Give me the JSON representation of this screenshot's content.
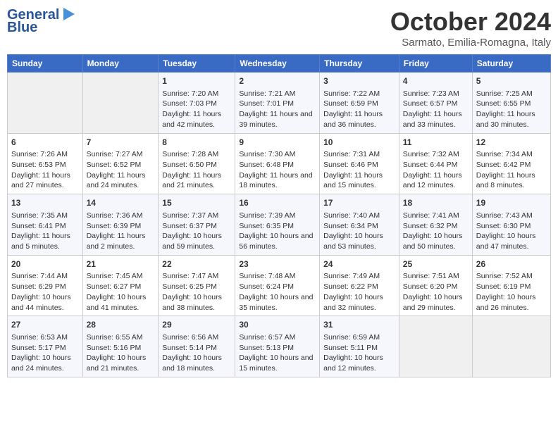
{
  "header": {
    "logo_line1": "General",
    "logo_line2": "Blue",
    "month_title": "October 2024",
    "location": "Sarmato, Emilia-Romagna, Italy"
  },
  "days_of_week": [
    "Sunday",
    "Monday",
    "Tuesday",
    "Wednesday",
    "Thursday",
    "Friday",
    "Saturday"
  ],
  "weeks": [
    [
      {
        "day": "",
        "empty": true
      },
      {
        "day": "",
        "empty": true
      },
      {
        "day": "1",
        "sunrise": "7:20 AM",
        "sunset": "7:03 PM",
        "daylight": "11 hours and 42 minutes."
      },
      {
        "day": "2",
        "sunrise": "7:21 AM",
        "sunset": "7:01 PM",
        "daylight": "11 hours and 39 minutes."
      },
      {
        "day": "3",
        "sunrise": "7:22 AM",
        "sunset": "6:59 PM",
        "daylight": "11 hours and 36 minutes."
      },
      {
        "day": "4",
        "sunrise": "7:23 AM",
        "sunset": "6:57 PM",
        "daylight": "11 hours and 33 minutes."
      },
      {
        "day": "5",
        "sunrise": "7:25 AM",
        "sunset": "6:55 PM",
        "daylight": "11 hours and 30 minutes."
      }
    ],
    [
      {
        "day": "6",
        "sunrise": "7:26 AM",
        "sunset": "6:53 PM",
        "daylight": "11 hours and 27 minutes."
      },
      {
        "day": "7",
        "sunrise": "7:27 AM",
        "sunset": "6:52 PM",
        "daylight": "11 hours and 24 minutes."
      },
      {
        "day": "8",
        "sunrise": "7:28 AM",
        "sunset": "6:50 PM",
        "daylight": "11 hours and 21 minutes."
      },
      {
        "day": "9",
        "sunrise": "7:30 AM",
        "sunset": "6:48 PM",
        "daylight": "11 hours and 18 minutes."
      },
      {
        "day": "10",
        "sunrise": "7:31 AM",
        "sunset": "6:46 PM",
        "daylight": "11 hours and 15 minutes."
      },
      {
        "day": "11",
        "sunrise": "7:32 AM",
        "sunset": "6:44 PM",
        "daylight": "11 hours and 12 minutes."
      },
      {
        "day": "12",
        "sunrise": "7:34 AM",
        "sunset": "6:42 PM",
        "daylight": "11 hours and 8 minutes."
      }
    ],
    [
      {
        "day": "13",
        "sunrise": "7:35 AM",
        "sunset": "6:41 PM",
        "daylight": "11 hours and 5 minutes."
      },
      {
        "day": "14",
        "sunrise": "7:36 AM",
        "sunset": "6:39 PM",
        "daylight": "11 hours and 2 minutes."
      },
      {
        "day": "15",
        "sunrise": "7:37 AM",
        "sunset": "6:37 PM",
        "daylight": "10 hours and 59 minutes."
      },
      {
        "day": "16",
        "sunrise": "7:39 AM",
        "sunset": "6:35 PM",
        "daylight": "10 hours and 56 minutes."
      },
      {
        "day": "17",
        "sunrise": "7:40 AM",
        "sunset": "6:34 PM",
        "daylight": "10 hours and 53 minutes."
      },
      {
        "day": "18",
        "sunrise": "7:41 AM",
        "sunset": "6:32 PM",
        "daylight": "10 hours and 50 minutes."
      },
      {
        "day": "19",
        "sunrise": "7:43 AM",
        "sunset": "6:30 PM",
        "daylight": "10 hours and 47 minutes."
      }
    ],
    [
      {
        "day": "20",
        "sunrise": "7:44 AM",
        "sunset": "6:29 PM",
        "daylight": "10 hours and 44 minutes."
      },
      {
        "day": "21",
        "sunrise": "7:45 AM",
        "sunset": "6:27 PM",
        "daylight": "10 hours and 41 minutes."
      },
      {
        "day": "22",
        "sunrise": "7:47 AM",
        "sunset": "6:25 PM",
        "daylight": "10 hours and 38 minutes."
      },
      {
        "day": "23",
        "sunrise": "7:48 AM",
        "sunset": "6:24 PM",
        "daylight": "10 hours and 35 minutes."
      },
      {
        "day": "24",
        "sunrise": "7:49 AM",
        "sunset": "6:22 PM",
        "daylight": "10 hours and 32 minutes."
      },
      {
        "day": "25",
        "sunrise": "7:51 AM",
        "sunset": "6:20 PM",
        "daylight": "10 hours and 29 minutes."
      },
      {
        "day": "26",
        "sunrise": "7:52 AM",
        "sunset": "6:19 PM",
        "daylight": "10 hours and 26 minutes."
      }
    ],
    [
      {
        "day": "27",
        "sunrise": "6:53 AM",
        "sunset": "5:17 PM",
        "daylight": "10 hours and 24 minutes."
      },
      {
        "day": "28",
        "sunrise": "6:55 AM",
        "sunset": "5:16 PM",
        "daylight": "10 hours and 21 minutes."
      },
      {
        "day": "29",
        "sunrise": "6:56 AM",
        "sunset": "5:14 PM",
        "daylight": "10 hours and 18 minutes."
      },
      {
        "day": "30",
        "sunrise": "6:57 AM",
        "sunset": "5:13 PM",
        "daylight": "10 hours and 15 minutes."
      },
      {
        "day": "31",
        "sunrise": "6:59 AM",
        "sunset": "5:11 PM",
        "daylight": "10 hours and 12 minutes."
      },
      {
        "day": "",
        "empty": true
      },
      {
        "day": "",
        "empty": true
      }
    ]
  ],
  "labels": {
    "sunrise": "Sunrise:",
    "sunset": "Sunset:",
    "daylight": "Daylight:"
  }
}
